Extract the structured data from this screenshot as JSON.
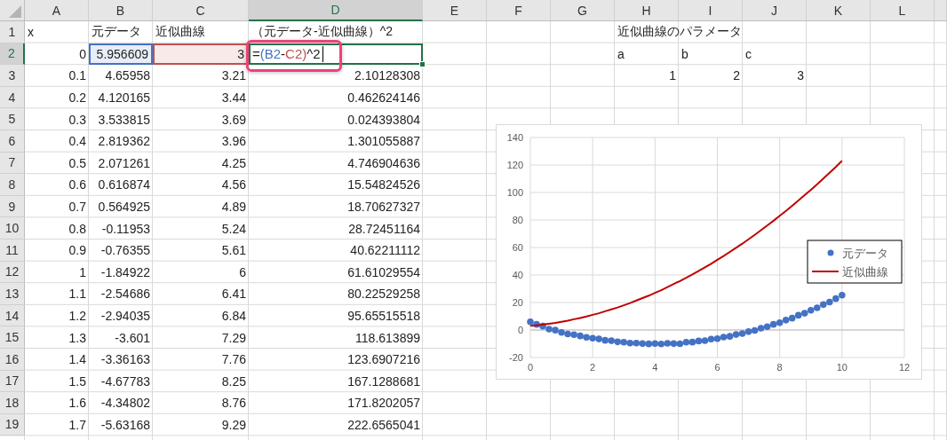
{
  "columns": [
    {
      "label": "A",
      "selected": false
    },
    {
      "label": "B",
      "selected": false
    },
    {
      "label": "C",
      "selected": false
    },
    {
      "label": "D",
      "selected": true
    },
    {
      "label": "E",
      "selected": false
    },
    {
      "label": "F",
      "selected": false
    },
    {
      "label": "G",
      "selected": false
    },
    {
      "label": "H",
      "selected": false
    },
    {
      "label": "I",
      "selected": false
    },
    {
      "label": "J",
      "selected": false
    },
    {
      "label": "K",
      "selected": false
    },
    {
      "label": "L",
      "selected": false
    }
  ],
  "rows": [
    {
      "number": "1",
      "selected": false,
      "cells": [
        {
          "text": "x",
          "kind": "text"
        },
        {
          "text": "元データ",
          "kind": "text"
        },
        {
          "text": "近似曲線",
          "kind": "text"
        },
        {
          "text": "（元データ-近似曲線）^2",
          "kind": "text"
        },
        null,
        null,
        null,
        {
          "text": "近似曲線のパラメータ",
          "kind": "text"
        }
      ]
    },
    {
      "number": "2",
      "selected": true,
      "cells": [
        "0",
        {
          "text": "5.956609",
          "kind": "reference",
          "color": "#4472c4"
        },
        {
          "text": "3",
          "kind": "reference",
          "color": "#c0504d"
        },
        {
          "kind": "formula",
          "highlighted": true,
          "parts": [
            {
              "text": "="
            },
            {
              "text": "(B2",
              "color": "#4472c4"
            },
            {
              "text": "-"
            },
            {
              "text": "C2)",
              "color": "#c0504d"
            },
            {
              "text": "^2"
            }
          ]
        },
        null,
        null,
        null,
        {
          "text": "a",
          "kind": "text"
        },
        {
          "text": "b",
          "kind": "text"
        },
        {
          "text": "c",
          "kind": "text"
        }
      ]
    },
    {
      "number": "3",
      "selected": false,
      "cells": [
        "0.1",
        "4.65958",
        "3.21",
        "2.10128308",
        null,
        null,
        null,
        "1",
        "2",
        "3"
      ]
    },
    {
      "number": "4",
      "selected": false,
      "cells": [
        "0.2",
        "4.120165",
        "3.44",
        "0.462624146"
      ]
    },
    {
      "number": "5",
      "selected": false,
      "cells": [
        "0.3",
        "3.533815",
        "3.69",
        "0.024393804"
      ]
    },
    {
      "number": "6",
      "selected": false,
      "cells": [
        "0.4",
        "2.819362",
        "3.96",
        "1.301055887"
      ]
    },
    {
      "number": "7",
      "selected": false,
      "cells": [
        "0.5",
        "2.071261",
        "4.25",
        "4.746904636"
      ]
    },
    {
      "number": "8",
      "selected": false,
      "cells": [
        "0.6",
        "0.616874",
        "4.56",
        "15.54824526"
      ]
    },
    {
      "number": "9",
      "selected": false,
      "cells": [
        "0.7",
        "0.564925",
        "4.89",
        "18.70627327"
      ]
    },
    {
      "number": "10",
      "selected": false,
      "cells": [
        "0.8",
        "-0.11953",
        "5.24",
        "28.72451164"
      ]
    },
    {
      "number": "11",
      "selected": false,
      "cells": [
        "0.9",
        "-0.76355",
        "5.61",
        "40.62211112"
      ]
    },
    {
      "number": "12",
      "selected": false,
      "cells": [
        "1",
        "-1.84922",
        "6",
        "61.61029554"
      ]
    },
    {
      "number": "13",
      "selected": false,
      "cells": [
        "1.1",
        "-2.54686",
        "6.41",
        "80.22529258"
      ]
    },
    {
      "number": "14",
      "selected": false,
      "cells": [
        "1.2",
        "-2.94035",
        "6.84",
        "95.65515518"
      ]
    },
    {
      "number": "15",
      "selected": false,
      "cells": [
        "1.3",
        "-3.601",
        "7.29",
        "118.613899"
      ]
    },
    {
      "number": "16",
      "selected": false,
      "cells": [
        "1.4",
        "-3.36163",
        "7.76",
        "123.6907216"
      ]
    },
    {
      "number": "17",
      "selected": false,
      "cells": [
        "1.5",
        "-4.67783",
        "8.25",
        "167.1288681"
      ]
    },
    {
      "number": "18",
      "selected": false,
      "cells": [
        "1.6",
        "-4.34802",
        "8.76",
        "171.8202057"
      ]
    },
    {
      "number": "19",
      "selected": false,
      "cells": [
        "1.7",
        "-5.63168",
        "9.29",
        "222.6565041"
      ]
    }
  ],
  "chart": {
    "chart_data": {
      "type": "scatter",
      "x": [
        0,
        0.2,
        0.4,
        0.6,
        0.8,
        1,
        1.2,
        1.4,
        1.6,
        1.8,
        2,
        2.2,
        2.4,
        2.6,
        2.8,
        3,
        3.2,
        3.4,
        3.6,
        3.8,
        4,
        4.2,
        4.4,
        4.6,
        4.8,
        5,
        5.2,
        5.4,
        5.6,
        5.8,
        6,
        6.2,
        6.4,
        6.6,
        6.8,
        7,
        7.2,
        7.4,
        7.6,
        7.8,
        8,
        8.2,
        8.4,
        8.6,
        8.8,
        9,
        9.2,
        9.4,
        9.6,
        9.8,
        10
      ],
      "series": [
        {
          "name": "元データ",
          "color": "#4472c4",
          "values": [
            6.0,
            4.1,
            2.8,
            0.6,
            -0.1,
            -1.8,
            -2.9,
            -3.4,
            -4.3,
            -5.3,
            -6.0,
            -6.5,
            -7.5,
            -7.8,
            -8.6,
            -8.9,
            -9.5,
            -9.5,
            -9.9,
            -10.1,
            -9.8,
            -10.2,
            -9.7,
            -9.9,
            -10.0,
            -8.9,
            -8.8,
            -8.0,
            -7.7,
            -6.6,
            -6.3,
            -5.2,
            -4.6,
            -3.3,
            -2.6,
            -1.2,
            -0.3,
            1.3,
            2.4,
            4.1,
            5.3,
            7.2,
            8.6,
            10.7,
            12.2,
            14.4,
            16.1,
            18.5,
            20.3,
            22.8,
            25.3
          ]
        },
        {
          "name": "近似曲線",
          "color": "#c00000",
          "type": "line",
          "values": [
            3,
            3.4,
            4,
            4.6,
            5.2,
            6,
            6.8,
            7.8,
            8.8,
            9.8,
            11,
            12.2,
            13.6,
            15,
            16.4,
            18,
            19.6,
            21.4,
            23.2,
            25,
            27,
            29,
            31.2,
            33.4,
            35.6,
            38,
            40.4,
            43,
            45.6,
            48.2,
            51,
            53.8,
            56.8,
            59.8,
            62.8,
            66,
            69.2,
            72.6,
            76,
            79.4,
            83,
            86.6,
            90.4,
            94.2,
            98,
            102,
            106,
            110.2,
            114.4,
            118.6,
            123
          ]
        }
      ],
      "grid": true,
      "legend": true,
      "xlim": [
        0,
        12
      ],
      "ylim": [
        -20,
        140
      ],
      "xticks": [
        {
          "value": 0,
          "label": "0"
        },
        {
          "value": 2,
          "label": "2"
        },
        {
          "value": 4,
          "label": "4"
        },
        {
          "value": 6,
          "label": "6"
        },
        {
          "value": 8,
          "label": "8"
        },
        {
          "value": 10,
          "label": "10"
        },
        {
          "value": 12,
          "label": "12"
        }
      ],
      "yticks": [
        {
          "value": -20,
          "label": "-20"
        },
        {
          "value": 0,
          "label": "0"
        },
        {
          "value": 20,
          "label": "20"
        },
        {
          "value": 40,
          "label": "40"
        },
        {
          "value": 60,
          "label": "60"
        },
        {
          "value": 80,
          "label": "80"
        },
        {
          "value": 100,
          "label": "100"
        },
        {
          "value": 120,
          "label": "120"
        },
        {
          "value": 140,
          "label": "140"
        }
      ]
    }
  }
}
